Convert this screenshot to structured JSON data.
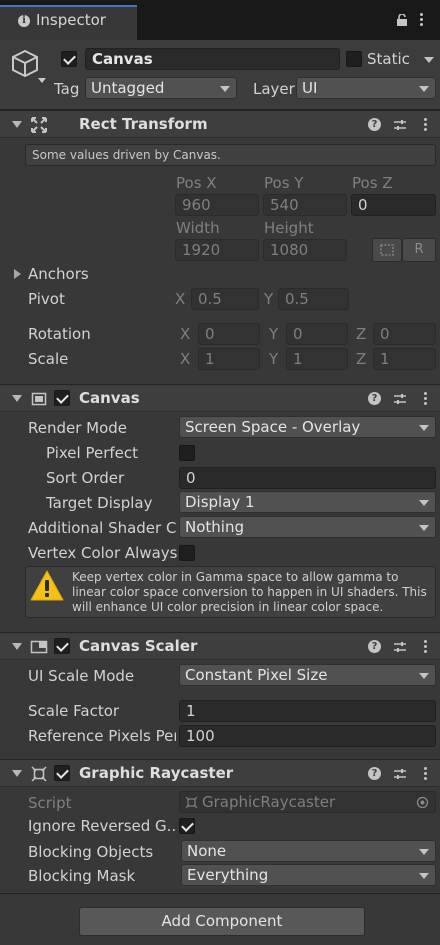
{
  "tab": {
    "title": "Inspector",
    "icon": "info-icon"
  },
  "gameobject": {
    "name": "Canvas",
    "active": true,
    "static_label": "Static",
    "static": false,
    "tag_label": "Tag",
    "tag_value": "Untagged",
    "layer_label": "Layer",
    "layer_value": "UI"
  },
  "rect_transform": {
    "title": "Rect Transform",
    "info": "Some values driven by Canvas.",
    "pos_x_label": "Pos X",
    "pos_y_label": "Pos Y",
    "pos_z_label": "Pos Z",
    "pos_x": "960",
    "pos_y": "540",
    "pos_z": "0",
    "width_label": "Width",
    "height_label": "Height",
    "width": "1920",
    "height": "1080",
    "r_button": "R",
    "anchors_label": "Anchors",
    "pivot_label": "Pivot",
    "pivot_x": "0.5",
    "pivot_y": "0.5",
    "rotation_label": "Rotation",
    "rot_x": "0",
    "rot_y": "0",
    "rot_z": "0",
    "scale_label": "Scale",
    "scale_x": "1",
    "scale_y": "1",
    "scale_z": "1",
    "x": "X",
    "y": "Y",
    "z": "Z"
  },
  "canvas": {
    "title": "Canvas",
    "enabled": true,
    "render_mode_label": "Render Mode",
    "render_mode": "Screen Space - Overlay",
    "pixel_perfect_label": "Pixel Perfect",
    "pixel_perfect": false,
    "sort_order_label": "Sort Order",
    "sort_order": "0",
    "target_display_label": "Target Display",
    "target_display": "Display 1",
    "shader_channels_label": "Additional Shader Ch",
    "shader_channels": "Nothing",
    "vertex_color_label": "Vertex Color Always",
    "vertex_color": false,
    "warning": "Keep vertex color in Gamma space to allow gamma to linear color space conversion to happen in UI shaders. This will enhance UI color precision in linear color space."
  },
  "canvas_scaler": {
    "title": "Canvas Scaler",
    "enabled": true,
    "ui_scale_mode_label": "UI Scale Mode",
    "ui_scale_mode": "Constant Pixel Size",
    "scale_factor_label": "Scale Factor",
    "scale_factor": "1",
    "ref_pixels_label": "Reference Pixels Per",
    "ref_pixels": "100"
  },
  "graphic_raycaster": {
    "title": "Graphic Raycaster",
    "enabled": true,
    "script_label": "Script",
    "script_value": "GraphicRaycaster",
    "ignore_reversed_label": "Ignore Reversed G...",
    "ignore_reversed": true,
    "blocking_objects_label": "Blocking Objects",
    "blocking_objects": "None",
    "blocking_mask_label": "Blocking Mask",
    "blocking_mask": "Everything"
  },
  "add_component": "Add Component"
}
